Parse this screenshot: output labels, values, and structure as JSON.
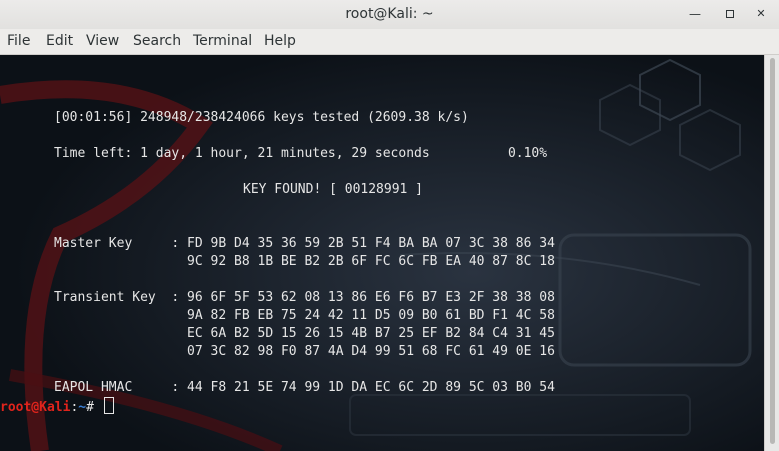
{
  "window": {
    "title": "root@Kali: ~"
  },
  "menubar": {
    "file": "File",
    "edit": "Edit",
    "view": "View",
    "search": "Search",
    "terminal": "Terminal",
    "help": "Help"
  },
  "terminal_lines": {
    "l1": "[00:01:56] 248948/238424066 keys tested (2609.38 k/s)",
    "l2": "Time left: 1 day, 1 hour, 21 minutes, 29 seconds          0.10%",
    "l3": "KEY FOUND! [ 00128991 ]",
    "l4": "Master Key     : FD 9B D4 35 36 59 2B 51 F4 BA BA 07 3C 38 86 34",
    "l5": "                 9C 92 B8 1B BE B2 2B 6F FC 6C FB EA 40 87 8C 18",
    "l6": "Transient Key  : 96 6F 5F 53 62 08 13 86 E6 F6 B7 E3 2F 38 38 08",
    "l7": "                 9A 82 FB EB 75 24 42 11 D5 09 B0 61 BD F1 4C 58",
    "l8": "                 EC 6A B2 5D 15 26 15 4B B7 25 EF B2 84 C4 31 45",
    "l9": "                 07 3C 82 98 F0 87 4A D4 99 51 68 FC 61 49 0E 16",
    "l10": "EAPOL HMAC     : 44 F8 21 5E 74 99 1D DA EC 6C 2D 89 5C 03 B0 54"
  },
  "prompt": {
    "user_host": "root@Kali",
    "sep": ":",
    "path": "~",
    "symbol": "# "
  },
  "colors": {
    "prompt_user": "#e0241c",
    "prompt_path": "#3a7fd6",
    "terminal_bg": "#0e1319"
  }
}
